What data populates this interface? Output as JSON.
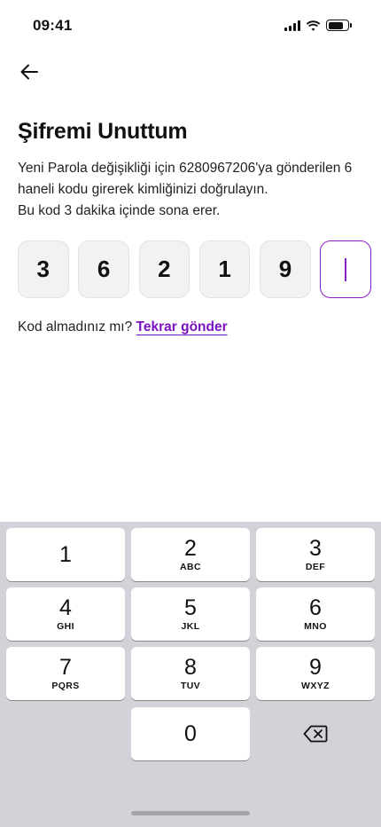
{
  "status_bar": {
    "time": "09:41"
  },
  "screen": {
    "title": "Şifremi Unuttum",
    "instruction_line1": "Yeni Parola değişikliği için 6280967206'ya gönderilen 6 haneli kodu girerek kimliğinizi doğrulayın.",
    "instruction_line2": "Bu kod 3 dakika içinde sona erer."
  },
  "otp": {
    "digits": [
      "3",
      "6",
      "2",
      "1",
      "9",
      ""
    ],
    "active_index": 5
  },
  "resend": {
    "prompt": "Kod almadınız mı?",
    "link": "Tekrar gönder"
  },
  "keyboard": {
    "keys": [
      {
        "num": "1",
        "letters": ""
      },
      {
        "num": "2",
        "letters": "ABC"
      },
      {
        "num": "3",
        "letters": "DEF"
      },
      {
        "num": "4",
        "letters": "GHI"
      },
      {
        "num": "5",
        "letters": "JKL"
      },
      {
        "num": "6",
        "letters": "MNO"
      },
      {
        "num": "7",
        "letters": "PQRS"
      },
      {
        "num": "8",
        "letters": "TUV"
      },
      {
        "num": "9",
        "letters": "WXYZ"
      },
      {
        "num": "0",
        "letters": ""
      }
    ],
    "delete_icon": "backspace-icon"
  },
  "colors": {
    "accent": "#7a10c2",
    "otp_active_border": "#8a1fc7",
    "keyboard_bg": "#d1d3d8"
  }
}
